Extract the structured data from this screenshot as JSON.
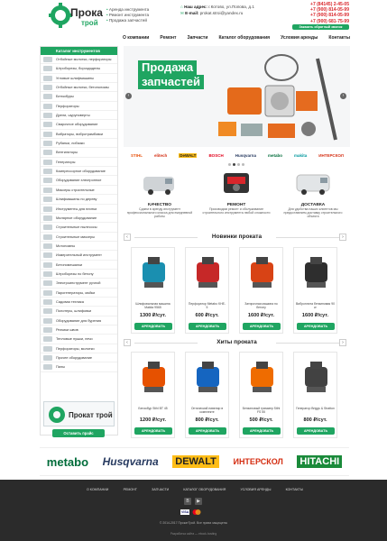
{
  "header": {
    "logo_main": "Прокат",
    "logo_sub": "трой",
    "services": [
      "Аренда инструмента",
      "Ремонт инструмента",
      "Продажа запчастей"
    ],
    "address_label": "Наш адрес:",
    "address": "г.Котово, ул.Попова, д.1",
    "email_label": "E-mail:",
    "email": "prokat.stroi@yandex.ru",
    "phones": [
      "+7 (84145) 2-45-05",
      "+7 (900) 814-05-99",
      "+7 (900) 814-05-99",
      "+7 (900) 681-75-99"
    ],
    "callback": "Заказать обратный звонок"
  },
  "nav": [
    "О компании",
    "Ремонт",
    "Запчасти",
    "Каталог оборудования",
    "Условия аренды",
    "Контакты"
  ],
  "sidebar": {
    "title": "Каталог инструментов",
    "items": [
      "Отбойные молотки, перфораторы",
      "Штроборезы, бороздоделы",
      "Угловые шлифмашины",
      "Отбойные молотки, бетоноломы",
      "Бензобуры",
      "Перфораторы",
      "Дрели, шуруповерты",
      "Сварочное оборудование",
      "Вибраторы, вибротрамбовки",
      "Рубанки, лобзики",
      "Вентиляторы",
      "Генераторы",
      "Компрессорное оборудование",
      "Оборудование электронное",
      "Миксеры строительные",
      "Шлифмашины по дереву",
      "Инструменты для плитки",
      "Малярное оборудование",
      "Строительные пылесосы",
      "Строительные миксеры",
      "Мотопомпы",
      "Измерительный инструмент",
      "Бетономешалки",
      "Штроборезы по бетону",
      "Электроинструмент ручной",
      "Парогенераторы, мойки",
      "Садовая техника",
      "Полотеры, шлифовки",
      "Оборудование для бурения",
      "Резчики швов",
      "Тепловые пушки, печи",
      "Перфораторы, молотки",
      "Прочее оборудование",
      "Пилы"
    ],
    "promo_title": "Прокат трой",
    "promo_button": "Оставить прайс"
  },
  "banner": {
    "title_line1": "Продажа",
    "title_line2": "запчастей"
  },
  "brand_row": [
    "STIHL",
    "elitech",
    "DeWALT",
    "BOSCH",
    "Husqvarna",
    "metabo",
    "makita",
    "ИНТЕРСКОЛ"
  ],
  "features": [
    {
      "title": "КАЧЕСТВО",
      "desc": "Сдаем в аренду инструмент профессионального класса для ежедневной работы"
    },
    {
      "title": "РЕМОНТ",
      "desc": "Производим ремонт и обслуживание строительного инструмента любой сложности"
    },
    {
      "title": "ДОСТАВКА",
      "desc": "Для удобства наших клиентов мы предоставляем доставку строительного объекта"
    }
  ],
  "new_section": {
    "title": "Новинки проката",
    "products": [
      {
        "name": "Шлифовальная машина Makita 9565",
        "price": "1300 ₽/сут.",
        "button": "АРЕНДОВАТЬ"
      },
      {
        "name": "Перфоратор Metabo KHE-5",
        "price": "600 ₽/сут.",
        "button": "АРЕНДОВАТЬ"
      },
      {
        "name": "Затирочная машина по бетону",
        "price": "1600 ₽/сут.",
        "button": "АРЕНДОВАТЬ"
      },
      {
        "name": "Виброплита бензиновая 90 кг",
        "price": "1600 ₽/сут.",
        "button": "АРЕНДОВАТЬ"
      }
    ]
  },
  "hits_section": {
    "title": "Хиты проката",
    "products": [
      {
        "name": "Бензобур Stihl BT 45",
        "price": "1200 ₽/сут.",
        "button": "АРЕНДОВАТЬ"
      },
      {
        "name": "Оптический нивелир в комплекте",
        "price": "800 ₽/сут.",
        "button": "АРЕНДОВАТЬ"
      },
      {
        "name": "Бензиновый триммер Stihl FS 55",
        "price": "500 ₽/сут.",
        "button": "АРЕНДОВАТЬ"
      },
      {
        "name": "Генератор Briggs & Stratton",
        "price": "800 ₽/сут.",
        "button": "АРЕНДОВАТЬ"
      }
    ]
  },
  "brands_bottom": [
    "metabo",
    "Husqvarna",
    "DEWALT",
    "ИНТЕРСКОЛ",
    "HITACHI"
  ],
  "footer": {
    "nav": [
      "О КОМПАНИИ",
      "РЕМОНТ",
      "ЗАПЧАСТИ",
      "КАТАЛОГ ОБОРУДОВАНИЯ",
      "УСЛОВИЯ АРЕНДЫ",
      "КОНТАКТЫ"
    ],
    "social": [
      "B",
      "▶"
    ],
    "payments": [
      "VISA",
      "MC"
    ],
    "copyright": "© 2014-2017 ПрокатТрой. Все права защищены",
    "developer": "Разработка сайта — ebook-hosting"
  },
  "colors": {
    "accent": "#1fa561",
    "phone": "#d9262b",
    "footer": "#2b2b2b"
  }
}
